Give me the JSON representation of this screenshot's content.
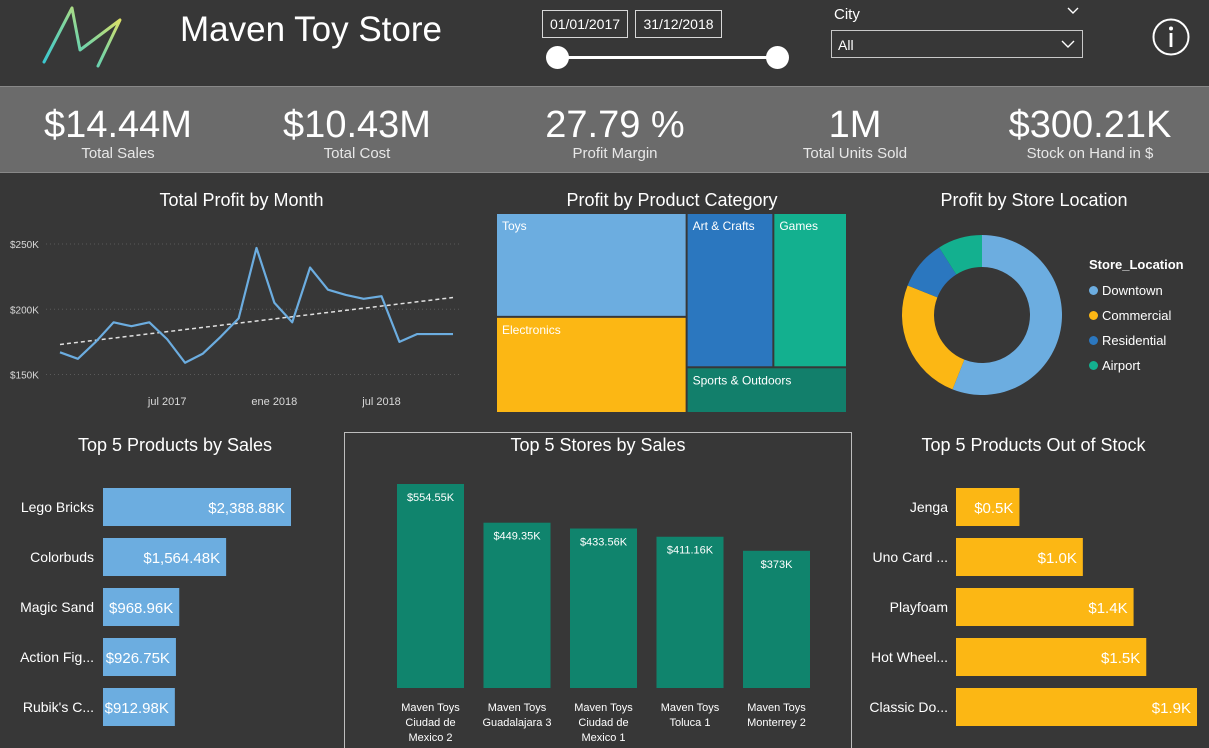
{
  "header": {
    "title": "Maven Toy Store",
    "date_start": "01/01/2017",
    "date_end": "31/12/2018",
    "city_label": "City",
    "city_value": "All",
    "logo_icon": "maven-logo",
    "info_icon": "info-icon"
  },
  "kpis": [
    {
      "value": "$14.44M",
      "label": "Total Sales"
    },
    {
      "value": "$10.43M",
      "label": "Total Cost"
    },
    {
      "value": "27.79 %",
      "label": "Profit Margin"
    },
    {
      "value": "1M",
      "label": "Total Units Sold"
    },
    {
      "value": "$300.21K",
      "label": "Stock on Hand in $"
    }
  ],
  "colors": {
    "background": "#373737",
    "kpi_band": "#6b6b6b",
    "blue": "#6cade0",
    "yellow": "#fcb714",
    "dark_blue": "#2b77bf",
    "teal": "#13b08f",
    "dark_teal": "#127f6b",
    "store_teal": "#10846d"
  },
  "chart_data": [
    {
      "type": "line",
      "title": "Total Profit by Month",
      "x": [
        "2017-01",
        "2017-02",
        "2017-03",
        "2017-04",
        "2017-05",
        "2017-06",
        "2017-07",
        "2017-08",
        "2017-09",
        "2017-10",
        "2017-11",
        "2017-12",
        "2018-01",
        "2018-02",
        "2018-03",
        "2018-04",
        "2018-05",
        "2018-06",
        "2018-07",
        "2018-08",
        "2018-09",
        "2018-10",
        "2018-11"
      ],
      "x_tick_labels": [
        "jul 2017",
        "ene 2018",
        "jul 2018"
      ],
      "y_tick_labels": [
        "$250K",
        "$200K",
        "$150K"
      ],
      "series": [
        {
          "values": [
            167,
            162,
            175,
            190,
            187,
            190,
            177,
            159,
            166,
            179,
            193,
            247,
            205,
            190,
            232,
            215,
            211,
            208,
            210,
            175,
            181,
            181,
            181
          ]
        }
      ],
      "trendline": {
        "start": 173,
        "end": 209
      },
      "ylim": [
        145,
        260
      ],
      "grid": true
    },
    {
      "type": "treemap",
      "title": "Profit by Product Category",
      "categories": [
        "Toys",
        "Electronics",
        "Art & Crafts",
        "Games",
        "Sports & Outdoors"
      ],
      "values": [
        1080,
        1000,
        730,
        620,
        400
      ]
    },
    {
      "type": "pie",
      "title": "Profit by Store Location",
      "legend_title": "Store_Location",
      "legend_position": "right",
      "categories": [
        "Downtown",
        "Commercial",
        "Residential",
        "Airport"
      ],
      "values": [
        56.0,
        25.0,
        10.0,
        9.0
      ]
    },
    {
      "type": "bar",
      "title": "Top 5 Products by Sales",
      "orientation": "horizontal",
      "categories": [
        "Lego Bricks",
        "Colorbuds",
        "Magic Sand",
        "Action Fig...",
        "Rubik's C..."
      ],
      "values": [
        2388.88,
        1564.48,
        968.96,
        926.75,
        912.98
      ],
      "value_labels": [
        "$2,388.88K",
        "$1,564.48K",
        "$968.96K",
        "$926.75K",
        "$912.98K"
      ]
    },
    {
      "type": "bar",
      "title": "Top 5 Stores by Sales",
      "orientation": "vertical",
      "categories": [
        [
          "Maven Toys",
          "Ciudad de",
          "Mexico 2"
        ],
        [
          "Maven Toys",
          "Guadalajara 3"
        ],
        [
          "Maven Toys",
          "Ciudad de",
          "Mexico 1"
        ],
        [
          "Maven Toys",
          "Toluca 1"
        ],
        [
          "Maven Toys",
          "Monterrey 2"
        ]
      ],
      "values": [
        554.55,
        449.35,
        433.56,
        411.16,
        373
      ],
      "value_labels": [
        "$554.55K",
        "$449.35K",
        "$433.56K",
        "$411.16K",
        "$373K"
      ]
    },
    {
      "type": "bar",
      "title": "Top 5 Products Out of Stock",
      "orientation": "horizontal",
      "categories": [
        "Jenga",
        "Uno Card ...",
        "Playfoam",
        "Hot Wheel...",
        "Classic Do..."
      ],
      "values": [
        0.5,
        1.0,
        1.4,
        1.5,
        1.9
      ],
      "value_labels": [
        "$0.5K",
        "$1.0K",
        "$1.4K",
        "$1.5K",
        "$1.9K"
      ]
    }
  ]
}
